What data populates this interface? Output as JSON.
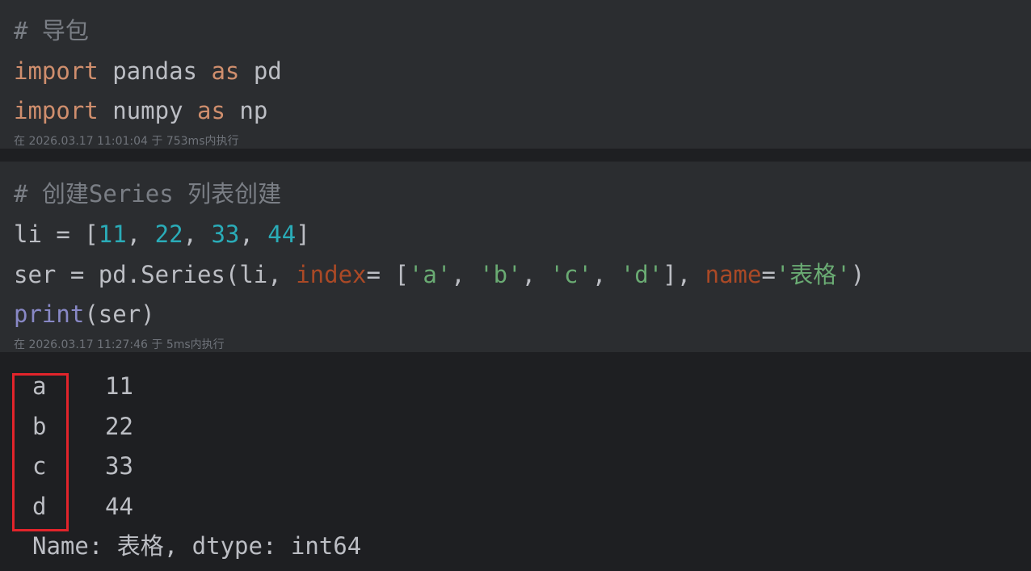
{
  "cell1": {
    "comment": "# 导包",
    "line2": {
      "kw1": "import",
      "mod": " pandas ",
      "kw2": "as",
      "alias": " pd"
    },
    "line3": {
      "kw1": "import",
      "mod": " numpy ",
      "kw2": "as",
      "alias": " np"
    },
    "meta": "在 2026.03.17 11:01:04 于 753ms内执行"
  },
  "cell2": {
    "comment": "# 创建Series 列表创建",
    "line2": {
      "a": "li = [",
      "n1": "11",
      "c1": ", ",
      "n2": "22",
      "c2": ", ",
      "n3": "33",
      "c3": ", ",
      "n4": "44",
      "end": "]"
    },
    "line3": {
      "p1": "ser = pd.Series(li, ",
      "param1": "index",
      "p2": "= [",
      "s1": "'a'",
      "c1": ", ",
      "s2": "'b'",
      "c2": ", ",
      "s3": "'c'",
      "c3": ", ",
      "s4": "'d'",
      "p3": "], ",
      "param2": "name",
      "p4": "=",
      "s5": "'表格'",
      "p5": ")"
    },
    "line4": {
      "fn": "print",
      "args": "(ser)"
    },
    "meta": "在 2026.03.17 11:27:46 于 5ms内执行"
  },
  "output": {
    "rows": [
      {
        "index": "a",
        "value": "11"
      },
      {
        "index": "b",
        "value": "22"
      },
      {
        "index": "c",
        "value": "33"
      },
      {
        "index": "d",
        "value": "44"
      }
    ],
    "footer": "Name: 表格, dtype: int64"
  },
  "colors": {
    "background": "#1e1f22",
    "cell_background": "#2b2d30",
    "keyword": "#cf8e6d",
    "number": "#2aacb8",
    "string": "#6aab73",
    "parameter": "#aa4926",
    "builtin": "#8888c6",
    "highlight_box": "#e2242b"
  }
}
